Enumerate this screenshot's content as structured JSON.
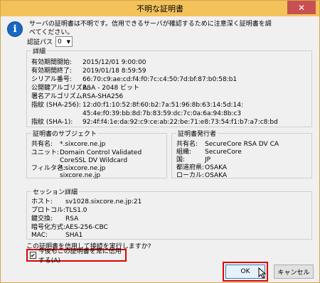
{
  "window": {
    "title": "不明な証明書",
    "close_glyph": "✕"
  },
  "message": {
    "icon": "info-icon",
    "line1": "サーバの証明書は不明です。信用できるサーバが確認するために注意深く証明書を調",
    "line2": "べてください。"
  },
  "path": {
    "label": "認証パス",
    "value": "0"
  },
  "details": {
    "legend": "詳細",
    "rows": [
      {
        "key": "有効期間開始:",
        "value": "2015/12/01 9:00:00"
      },
      {
        "key": "有効期間終了:",
        "value": "2019/01/18 8:59:59"
      },
      {
        "key": "シリアル番号:",
        "value": "66:70:c9:ae:cd:f4:f0:7c:c4:50:7d:bf:87:b0:58:b1"
      },
      {
        "key": "公開鍵アルゴリズム:",
        "value": "RSA - 2048 ビット"
      },
      {
        "key": "署名アルゴリズム:",
        "value": "RSA-SHA256"
      },
      {
        "key": "指紋 (SHA-256):",
        "value": "12:d0:f1:10:52:8f:60:b2:7a:51:96:8b:63:14:5d:14:",
        "value2": "45:4e:f0:39:bb:8d:7b:83:59:dc:7c:0a:6a:94:8b:c3"
      },
      {
        "key": "指紋 (SHA-1):",
        "value": "92:4f:f4:1e:da:92:c9:ce:ab:22:be:71:e8:73:54:f1:b7:a7:c8:bd"
      }
    ]
  },
  "subject": {
    "legend": "証明書のサブジェクト",
    "rows": [
      {
        "key": "共有名:",
        "value": "*.sixcore.ne.jp"
      },
      {
        "key": "ユニット:",
        "value": "Domain Control Validated",
        "value2": "CoreSSL DV Wildcard"
      },
      {
        "key": "フィルタ名:",
        "value": "*.sixcore.ne.jp",
        "value2": "sixcore.ne.jp"
      }
    ]
  },
  "issuer": {
    "legend": "証明書発行者",
    "rows": [
      {
        "key": "共有名:",
        "value": "SecureCore RSA DV CA"
      },
      {
        "key": "組織:",
        "value": "SecureCore"
      },
      {
        "key": "国:",
        "value": "JP"
      },
      {
        "key": "都道府県:",
        "value": "OSAKA"
      },
      {
        "key": "ローカル:",
        "value": "OSAKA"
      }
    ]
  },
  "session": {
    "legend": "セッション詳細",
    "rows": [
      {
        "key": "ホスト:",
        "value": "sv1028.sixcore.ne.jp:21"
      },
      {
        "key": "プロトコル:",
        "value": "TLS1.0"
      },
      {
        "key": "鍵交換:",
        "value": "RSA"
      },
      {
        "key": "暗号化方式:",
        "value": "AES-256-CBC"
      },
      {
        "key": "MAC:",
        "value": "SHA1"
      }
    ]
  },
  "question": "この証明書を信用して接続を実行しますか?",
  "checkbox": {
    "label": "今後もこの証明書を常に信用する(A)",
    "checked": true,
    "mark": "✔"
  },
  "buttons": {
    "ok": "OK",
    "cancel": "キャンセル"
  },
  "colors": {
    "titlebar": "#f3c25b",
    "close": "#c75050",
    "highlight": "#e00000",
    "info_icon": "#1a66c2"
  }
}
